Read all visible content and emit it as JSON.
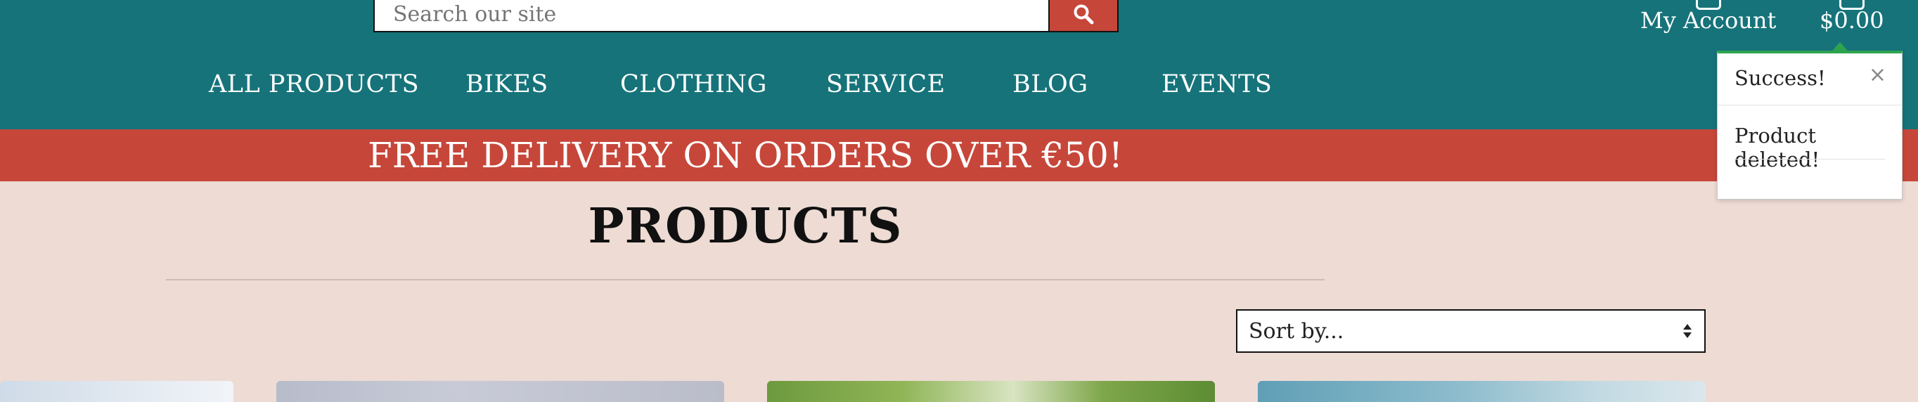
{
  "search": {
    "placeholder": "Search our site",
    "button_icon": "search-icon"
  },
  "header": {
    "account_label": "My Account",
    "cart_total": "$0.00"
  },
  "nav": {
    "items": [
      {
        "label": "ALL PRODUCTS"
      },
      {
        "label": "BIKES"
      },
      {
        "label": "CLOTHING"
      },
      {
        "label": "SERVICE"
      },
      {
        "label": "BLOG"
      },
      {
        "label": "EVENTS"
      }
    ]
  },
  "promo": {
    "text": "FREE DELIVERY ON ORDERS OVER €50!"
  },
  "main": {
    "title": "PRODUCTS",
    "sort_label": "Sort by..."
  },
  "toast": {
    "title": "Success!",
    "message": "Product deleted!",
    "close_icon": "close-icon"
  },
  "colors": {
    "header_bg": "#16737a",
    "accent_red": "#c6473a",
    "page_bg": "#eddbd4",
    "toast_success": "#2ea44f"
  }
}
